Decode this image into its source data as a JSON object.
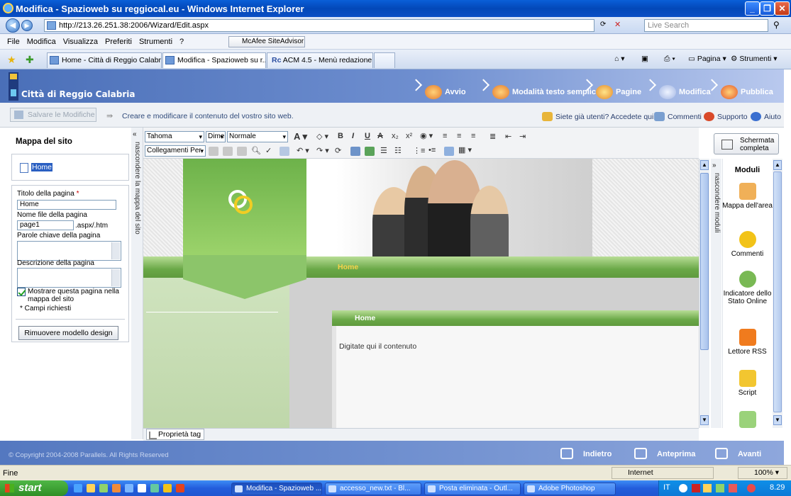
{
  "window": {
    "title": "Modifica - Spazioweb su reggiocal.eu - Windows Internet Explorer"
  },
  "browser": {
    "url": "http://213.26.251.38:2006/Wizard/Edit.aspx",
    "search_placeholder": "Live Search",
    "menu": [
      "File",
      "Modifica",
      "Visualizza",
      "Preferiti",
      "Strumenti",
      "?"
    ],
    "mcafee": "McAfee SiteAdvisor",
    "tabs": [
      {
        "label": "Home - Città di Reggio Calabria"
      },
      {
        "label": "Modifica - Spazioweb su r..."
      },
      {
        "label": "ACM 4.5 - Menù redazione"
      }
    ],
    "commands": {
      "page": "Pagina",
      "tools": "Strumenti"
    }
  },
  "app": {
    "logo_text": "Città di Reggio Calabria",
    "steps": [
      "Avvio",
      "Modalità testo semplice",
      "Pagine",
      "Modifica",
      "Pubblica"
    ],
    "save_button": "Salvare le Modifiche",
    "help_text": "Creare e modificare il contenuto del vostro sito web.",
    "right_links": {
      "existing_users": "Siete già utenti? Accedete qui...",
      "comments": "Commenti",
      "support": "Supporto",
      "help": "Aiuto"
    }
  },
  "left_panel": {
    "title": "Mappa del sito",
    "tree_item": "Home",
    "toggle_label": "nascondere la mappa del sito",
    "fields": {
      "page_title_label": "Titolo della pagina",
      "required_mark": "*",
      "page_title_value": "Home",
      "file_name_label": "Nome file della pagina",
      "file_name_value": "page1",
      "file_ext": ".aspx/.htm",
      "keywords_label": "Parole chiave della pagina",
      "description_label": "Descrizione della pagina",
      "show_in_map_label": "Mostrare questa pagina nella mappa del sito",
      "required_note": "* Campi richiesti"
    },
    "remove_design_button": "Rimuovere modello design"
  },
  "editor": {
    "font_family": "Tahoma",
    "font_size": "Dime",
    "style": "Normale",
    "links": "Collegamenti Per",
    "nav_home": "Home",
    "content_title": "Home",
    "content_placeholder": "Digitate qui il contenuto",
    "tag_properties": "Proprietà tag"
  },
  "right_panel": {
    "fullscreen": "Schermata completa",
    "toggle_label": "nascondere moduli",
    "title": "Moduli",
    "modules": [
      {
        "label": "Mappa dell'area",
        "icon": "map-icon"
      },
      {
        "label": "Commenti",
        "icon": "comment-icon"
      },
      {
        "label": "Indicatore dello Stato Online",
        "icon": "status-icon"
      },
      {
        "label": "Lettore RSS",
        "icon": "rss-icon"
      },
      {
        "label": "Script",
        "icon": "script-icon"
      }
    ]
  },
  "footer": {
    "copyright": "© Copyright 2004-2008 Parallels. All Rights Reserved",
    "back": "Indietro",
    "preview": "Anteprima",
    "next": "Avanti"
  },
  "statusbar": {
    "text": "Fine",
    "zone": "Internet",
    "zoom": "100%"
  },
  "taskbar": {
    "start": "start",
    "tasks": [
      "Modifica - Spazioweb ...",
      "accesso_new.txt - Bl...",
      "Posta eliminata - Outl...",
      "Adobe Photoshop"
    ],
    "lang": "IT",
    "time": "8.29"
  }
}
